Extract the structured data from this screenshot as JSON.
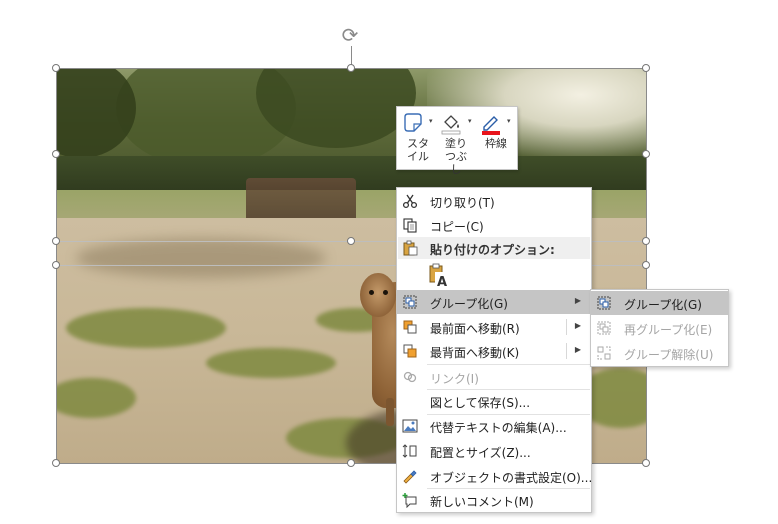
{
  "mini_toolbar": {
    "style_label": "スタイル",
    "fill_label": "塗りつぶし",
    "outline_label": "枠線",
    "outline_color": "#e8141c"
  },
  "context_menu": {
    "cut": "切り取り(T)",
    "copy": "コピー(C)",
    "paste_options_header": "貼り付けのオプション:",
    "group": "グループ化(G)",
    "bring_to_front": "最前面へ移動(R)",
    "send_to_back": "最背面へ移動(K)",
    "link": "リンク(I)",
    "save_as_picture": "図として保存(S)...",
    "edit_alt_text": "代替テキストの編集(A)...",
    "size_and_position": "配置とサイズ(Z)...",
    "format_object": "オブジェクトの書式設定(O)...",
    "new_comment": "新しいコメント(M)"
  },
  "group_submenu": {
    "group": "グループ化(G)",
    "regroup": "再グループ化(E)",
    "ungroup": "グループ解除(U)"
  },
  "colors": {
    "hover_bg": "#c5c5c5",
    "disabled_text": "#a5a5a5"
  }
}
